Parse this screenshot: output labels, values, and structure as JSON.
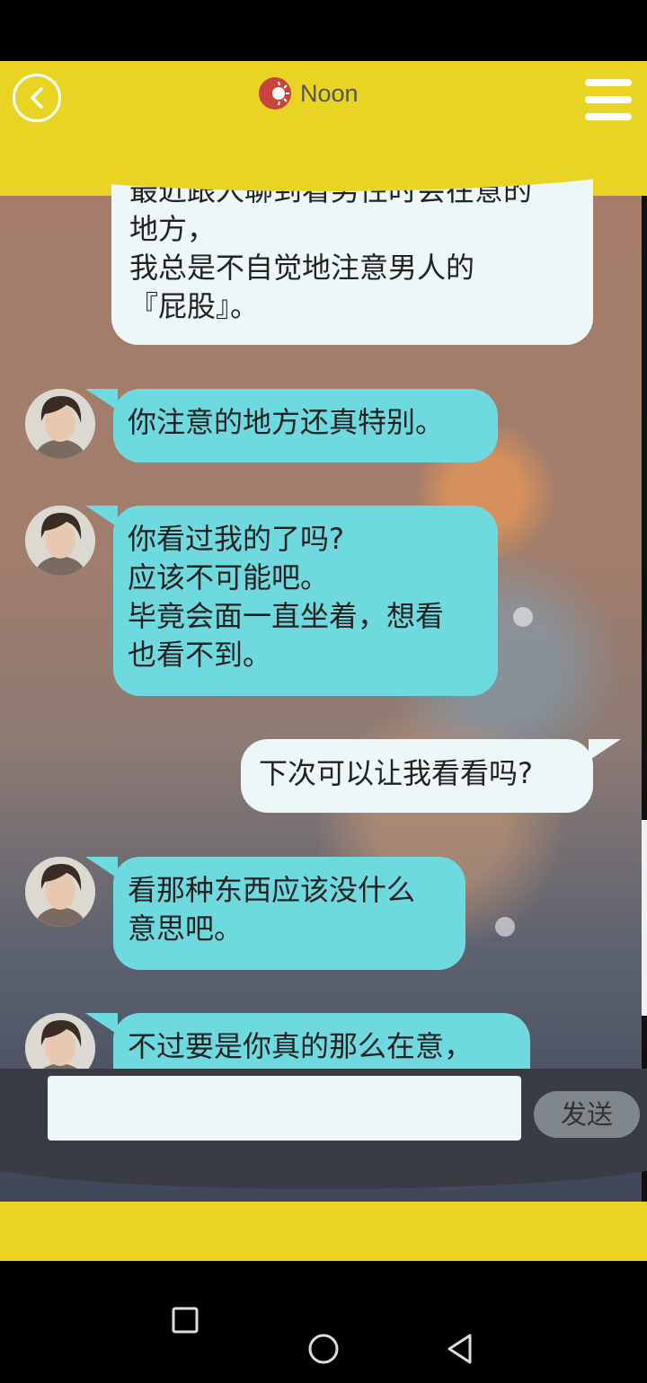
{
  "header": {
    "title": "Noon"
  },
  "messages": [
    {
      "side": "right",
      "text": "最近跟人聊到看男性时会在意的\n地方，\n我总是不自觉地注意男人的\n『屁股』。"
    },
    {
      "side": "left",
      "text": "你注意的地方还真特别。"
    },
    {
      "side": "left",
      "text": "你看过我的了吗?\n应该不可能吧。\n毕竟会面一直坐着，想看\n也看不到。"
    },
    {
      "side": "right",
      "text": "下次可以让我看看吗?"
    },
    {
      "side": "left",
      "text": "看那种东西应该没什么\n意思吧。"
    },
    {
      "side": "left",
      "text": "不过要是你真的那么在意，"
    }
  ],
  "composer": {
    "input_value": "",
    "send_label": "发送"
  },
  "colors": {
    "header": "#e9d424",
    "left_bubble": "#6fd9e0",
    "right_bubble": "#eef7f7",
    "input_bar": "#393b45"
  },
  "icons": [
    "back-icon",
    "time-of-day-icon",
    "menu-icon",
    "avatar",
    "nav-recents-icon",
    "nav-home-icon",
    "nav-back-icon"
  ]
}
